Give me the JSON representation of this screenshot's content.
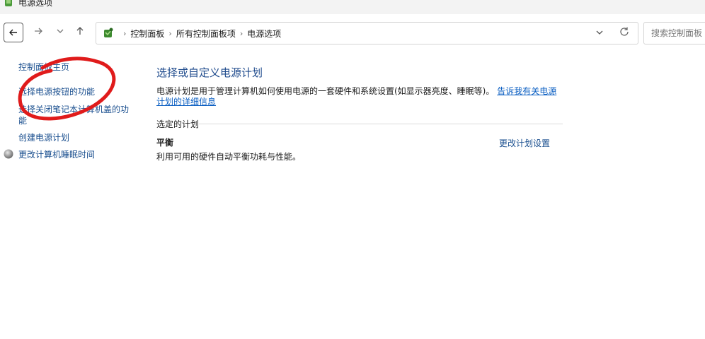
{
  "window": {
    "title": "电源选项"
  },
  "address": {
    "crumbs": [
      "控制面板",
      "所有控制面板项",
      "电源选项"
    ]
  },
  "search": {
    "placeholder": "搜索控制面板"
  },
  "sidebar": {
    "items": [
      {
        "label": "控制面板主页"
      },
      {
        "label": "选择电源按钮的功能"
      },
      {
        "label": "选择关闭笔记本计算机盖的功能"
      },
      {
        "label": "创建电源计划"
      },
      {
        "label": "更改计算机睡眠时间"
      }
    ]
  },
  "main": {
    "title": "选择或自定义电源计划",
    "description": "电源计划是用于管理计算机如何使用电源的一套硬件和系统设置(如显示器亮度、睡眠等)。",
    "description_link": "告诉我有关电源计划的详细信息",
    "section_label": "选定的计划",
    "plan": {
      "name": "平衡",
      "description": "利用可用的硬件自动平衡功耗与性能。",
      "settings_link": "更改计划设置"
    }
  },
  "colors": {
    "link": "#1a4f8f",
    "title": "#1e4a8c",
    "annotation": "#e01b1b"
  }
}
